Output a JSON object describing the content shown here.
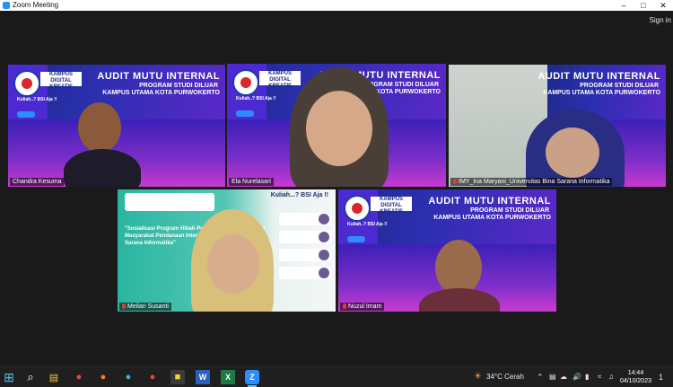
{
  "window": {
    "title": "Zoom Meeting",
    "controls": {
      "minimize": "–",
      "maximize": "□",
      "close": "✕"
    }
  },
  "header": {
    "sign_in": "Sign in"
  },
  "tiles": [
    {
      "name": "Chandra Kesuma",
      "muted": false,
      "active": false
    },
    {
      "name": "Ela Nurelasari",
      "muted": false,
      "active": true
    },
    {
      "name": "IMY_Ina Maryani_Universitas Bina Sarana Informatika",
      "muted": true,
      "active": false
    },
    {
      "name": "Meilan Susanti",
      "muted": true,
      "active": false
    },
    {
      "name": "Nuzul Imam",
      "muted": true,
      "active": false
    }
  ],
  "background": {
    "kampus": "KAMPUS DIGITAL KREATIF",
    "audit_title": "AUDIT MUTU INTERNAL",
    "audit_sub1": "PROGRAM STUDI DILUAR",
    "audit_sub2": "KAMPUS UTAMA KOTA PURWOKERTO",
    "kuliah": "Kuliah..? BSI Aja !!"
  },
  "green_slide": {
    "kuliah": "Kuliah...? BSI Aja !!",
    "title": "\"Sosialisasi Program Hibah Penelitian dan Pengabdian Masyarakat Pendanaan Internal Universitas Bina Sarana Informatika\""
  },
  "taskbar": {
    "apps": [
      {
        "icon": "windows-start-icon",
        "glyph": "⊞"
      },
      {
        "icon": "search-icon",
        "glyph": "⌕"
      },
      {
        "icon": "file-explorer-icon",
        "glyph": "▤"
      },
      {
        "icon": "chrome-icon",
        "glyph": "●"
      },
      {
        "icon": "firefox-icon",
        "glyph": "●"
      },
      {
        "icon": "edge-icon",
        "glyph": "●"
      },
      {
        "icon": "chrome-alt-icon",
        "glyph": "●"
      },
      {
        "icon": "sticky-notes-icon",
        "glyph": "■"
      },
      {
        "icon": "word-icon",
        "glyph": "W"
      },
      {
        "icon": "excel-icon",
        "glyph": "X"
      },
      {
        "icon": "zoom-icon",
        "glyph": "Z"
      }
    ],
    "weather": "34°C  Cerah",
    "time": "14:44",
    "date": "04/10/2023",
    "notifications": "1"
  },
  "colors": {
    "active_speaker": "#c7e84a",
    "zoom_blue": "#2d8cff",
    "muted_red": "#e53935"
  }
}
